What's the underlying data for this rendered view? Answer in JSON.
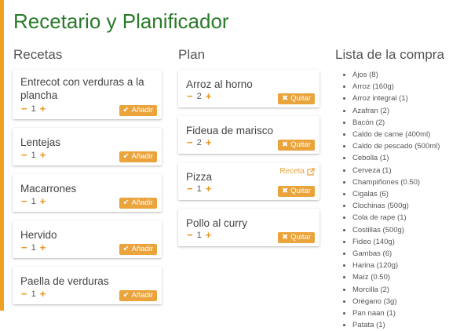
{
  "app": {
    "title": "Recetario y Planificador",
    "accent": "#f0a020",
    "title_color": "#2a7a2a"
  },
  "recipes": {
    "heading": "Recetas",
    "add_label": "Añadir",
    "items": [
      {
        "name": "Entrecot con verduras a la plancha",
        "qty": "1"
      },
      {
        "name": "Lentejas",
        "qty": "1"
      },
      {
        "name": "Macarrones",
        "qty": "1"
      },
      {
        "name": "Hervido",
        "qty": "1"
      },
      {
        "name": "Paella de verduras",
        "qty": "1"
      }
    ]
  },
  "plan": {
    "heading": "Plan",
    "remove_label": "Quitar",
    "recipe_link_label": "Receta",
    "items": [
      {
        "name": "Arroz al horno",
        "qty": "2"
      },
      {
        "name": "Fideua de marisco",
        "qty": "2"
      },
      {
        "name": "Pizza",
        "qty": "1"
      },
      {
        "name": "Pollo al curry",
        "qty": "1"
      }
    ]
  },
  "shopping": {
    "heading": "Lista de la compra",
    "items": [
      "Ajos (8)",
      "Arroz (160g)",
      "Arroz integral (1)",
      "Azafran (2)",
      "Bacón (2)",
      "Caldo de carne (400ml)",
      "Caldo de pescado (500ml)",
      "Cebolla (1)",
      "Cerveza (1)",
      "Champiñones (0.50)",
      "Cigalas (6)",
      "Clochinas (500g)",
      "Cola de rape (1)",
      "Costillas (500g)",
      "Fideo (140g)",
      "Gambas (6)",
      "Harina (120g)",
      "Maíz (0.50)",
      "Morcilla (2)",
      "Orégano (3g)",
      "Pan naan (1)",
      "Patata (1)"
    ]
  },
  "icons": {
    "minus": "−",
    "plus": "+",
    "check": "✔",
    "cross": "✖",
    "external": "external-link-icon"
  }
}
